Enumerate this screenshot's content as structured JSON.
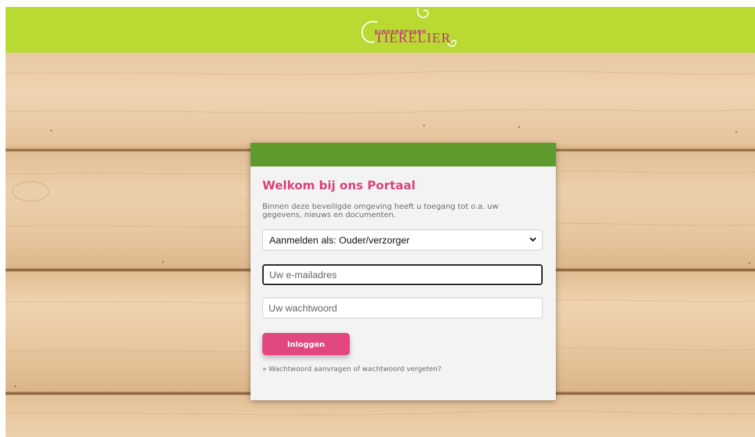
{
  "header": {
    "logo_small": "KINDEROPVANG",
    "logo_main": "TIERELIER"
  },
  "login": {
    "title": "Welkom bij ons Portaal",
    "intro": "Binnen deze beveiligde omgeving heeft u toegang tot o.a. uw gegevens, nieuws en documenten.",
    "role_select": "Aanmelden als: Ouder/verzorger",
    "email_placeholder": "Uw e-mailadres",
    "password_placeholder": "Uw wachtwoord",
    "login_button": "Inloggen",
    "forgot_link": "» Wachtwoord aanvragen of wachtwoord vergeten?"
  },
  "colors": {
    "topbar": "#b9d933",
    "card_header": "#5e9a2e",
    "accent_pink": "#d8437c",
    "button": "#e2487f"
  },
  "icons": [
    "swirl-logo-icon",
    "chevron-down-icon"
  ]
}
